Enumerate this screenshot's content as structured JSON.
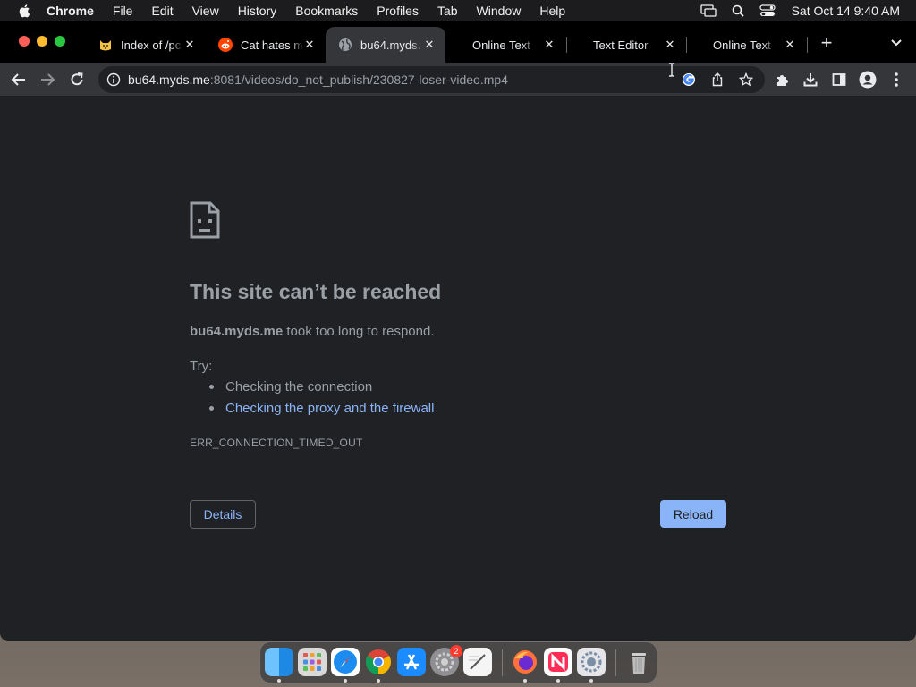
{
  "menubar": {
    "app_name": "Chrome",
    "items": [
      "File",
      "Edit",
      "View",
      "History",
      "Bookmarks",
      "Profiles",
      "Tab",
      "Window",
      "Help"
    ],
    "clock": "Sat Oct 14  9:40 AM"
  },
  "tabs": [
    {
      "title": "Index of /pc",
      "favicon": "cat-emoji-icon",
      "active": false
    },
    {
      "title": "Cat hates m",
      "favicon": "reddit-icon",
      "active": false
    },
    {
      "title": "bu64.myds.",
      "favicon": "globe-icon",
      "active": true
    },
    {
      "title": "Online Text",
      "favicon": "",
      "active": false
    },
    {
      "title": "Text Editor",
      "favicon": "",
      "active": false
    },
    {
      "title": "Online Text",
      "favicon": "",
      "active": false
    }
  ],
  "omnibox": {
    "host": "bu64.myds.me",
    "path": ":8081/videos/do_not_publish/230827-loser-video.mp4"
  },
  "error": {
    "title": "This site can’t be reached",
    "host": "bu64.myds.me",
    "message": " took too long to respond.",
    "try_label": "Try:",
    "suggestions": [
      "Checking the connection",
      "Checking the proxy and the firewall"
    ],
    "code": "ERR_CONNECTION_TIMED_OUT",
    "details_button": "Details",
    "reload_button": "Reload"
  },
  "dock": {
    "settings_badge": "2"
  },
  "colors": {
    "page_bg": "#202124",
    "link": "#8ab4f8",
    "text": "#9aa0a6",
    "toolbar": "#35363a"
  }
}
